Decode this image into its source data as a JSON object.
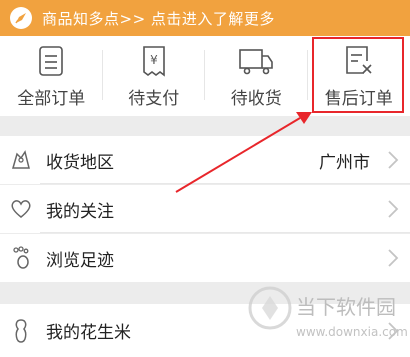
{
  "banner": {
    "text": "商品知多点>> 点击进入了解更多",
    "bg": "#f1a23f"
  },
  "orders": [
    {
      "label": "全部订单",
      "icon": "list-doc-icon"
    },
    {
      "label": "待支付",
      "icon": "yen-doc-icon"
    },
    {
      "label": "待收货",
      "icon": "truck-icon"
    },
    {
      "label": "售后订单",
      "icon": "doc-x-icon"
    }
  ],
  "menu": [
    {
      "label": "收货地区",
      "value": "广州市",
      "icon": "location-icon"
    },
    {
      "label": "我的关注",
      "icon": "heart-icon"
    },
    {
      "label": "浏览足迹",
      "icon": "footprint-icon"
    },
    {
      "label": "我的花生米",
      "icon": "peanut-icon"
    }
  ],
  "highlight_color": "#e8262b",
  "watermark": {
    "name": "当下软件园",
    "url": "www.downxia.com"
  }
}
